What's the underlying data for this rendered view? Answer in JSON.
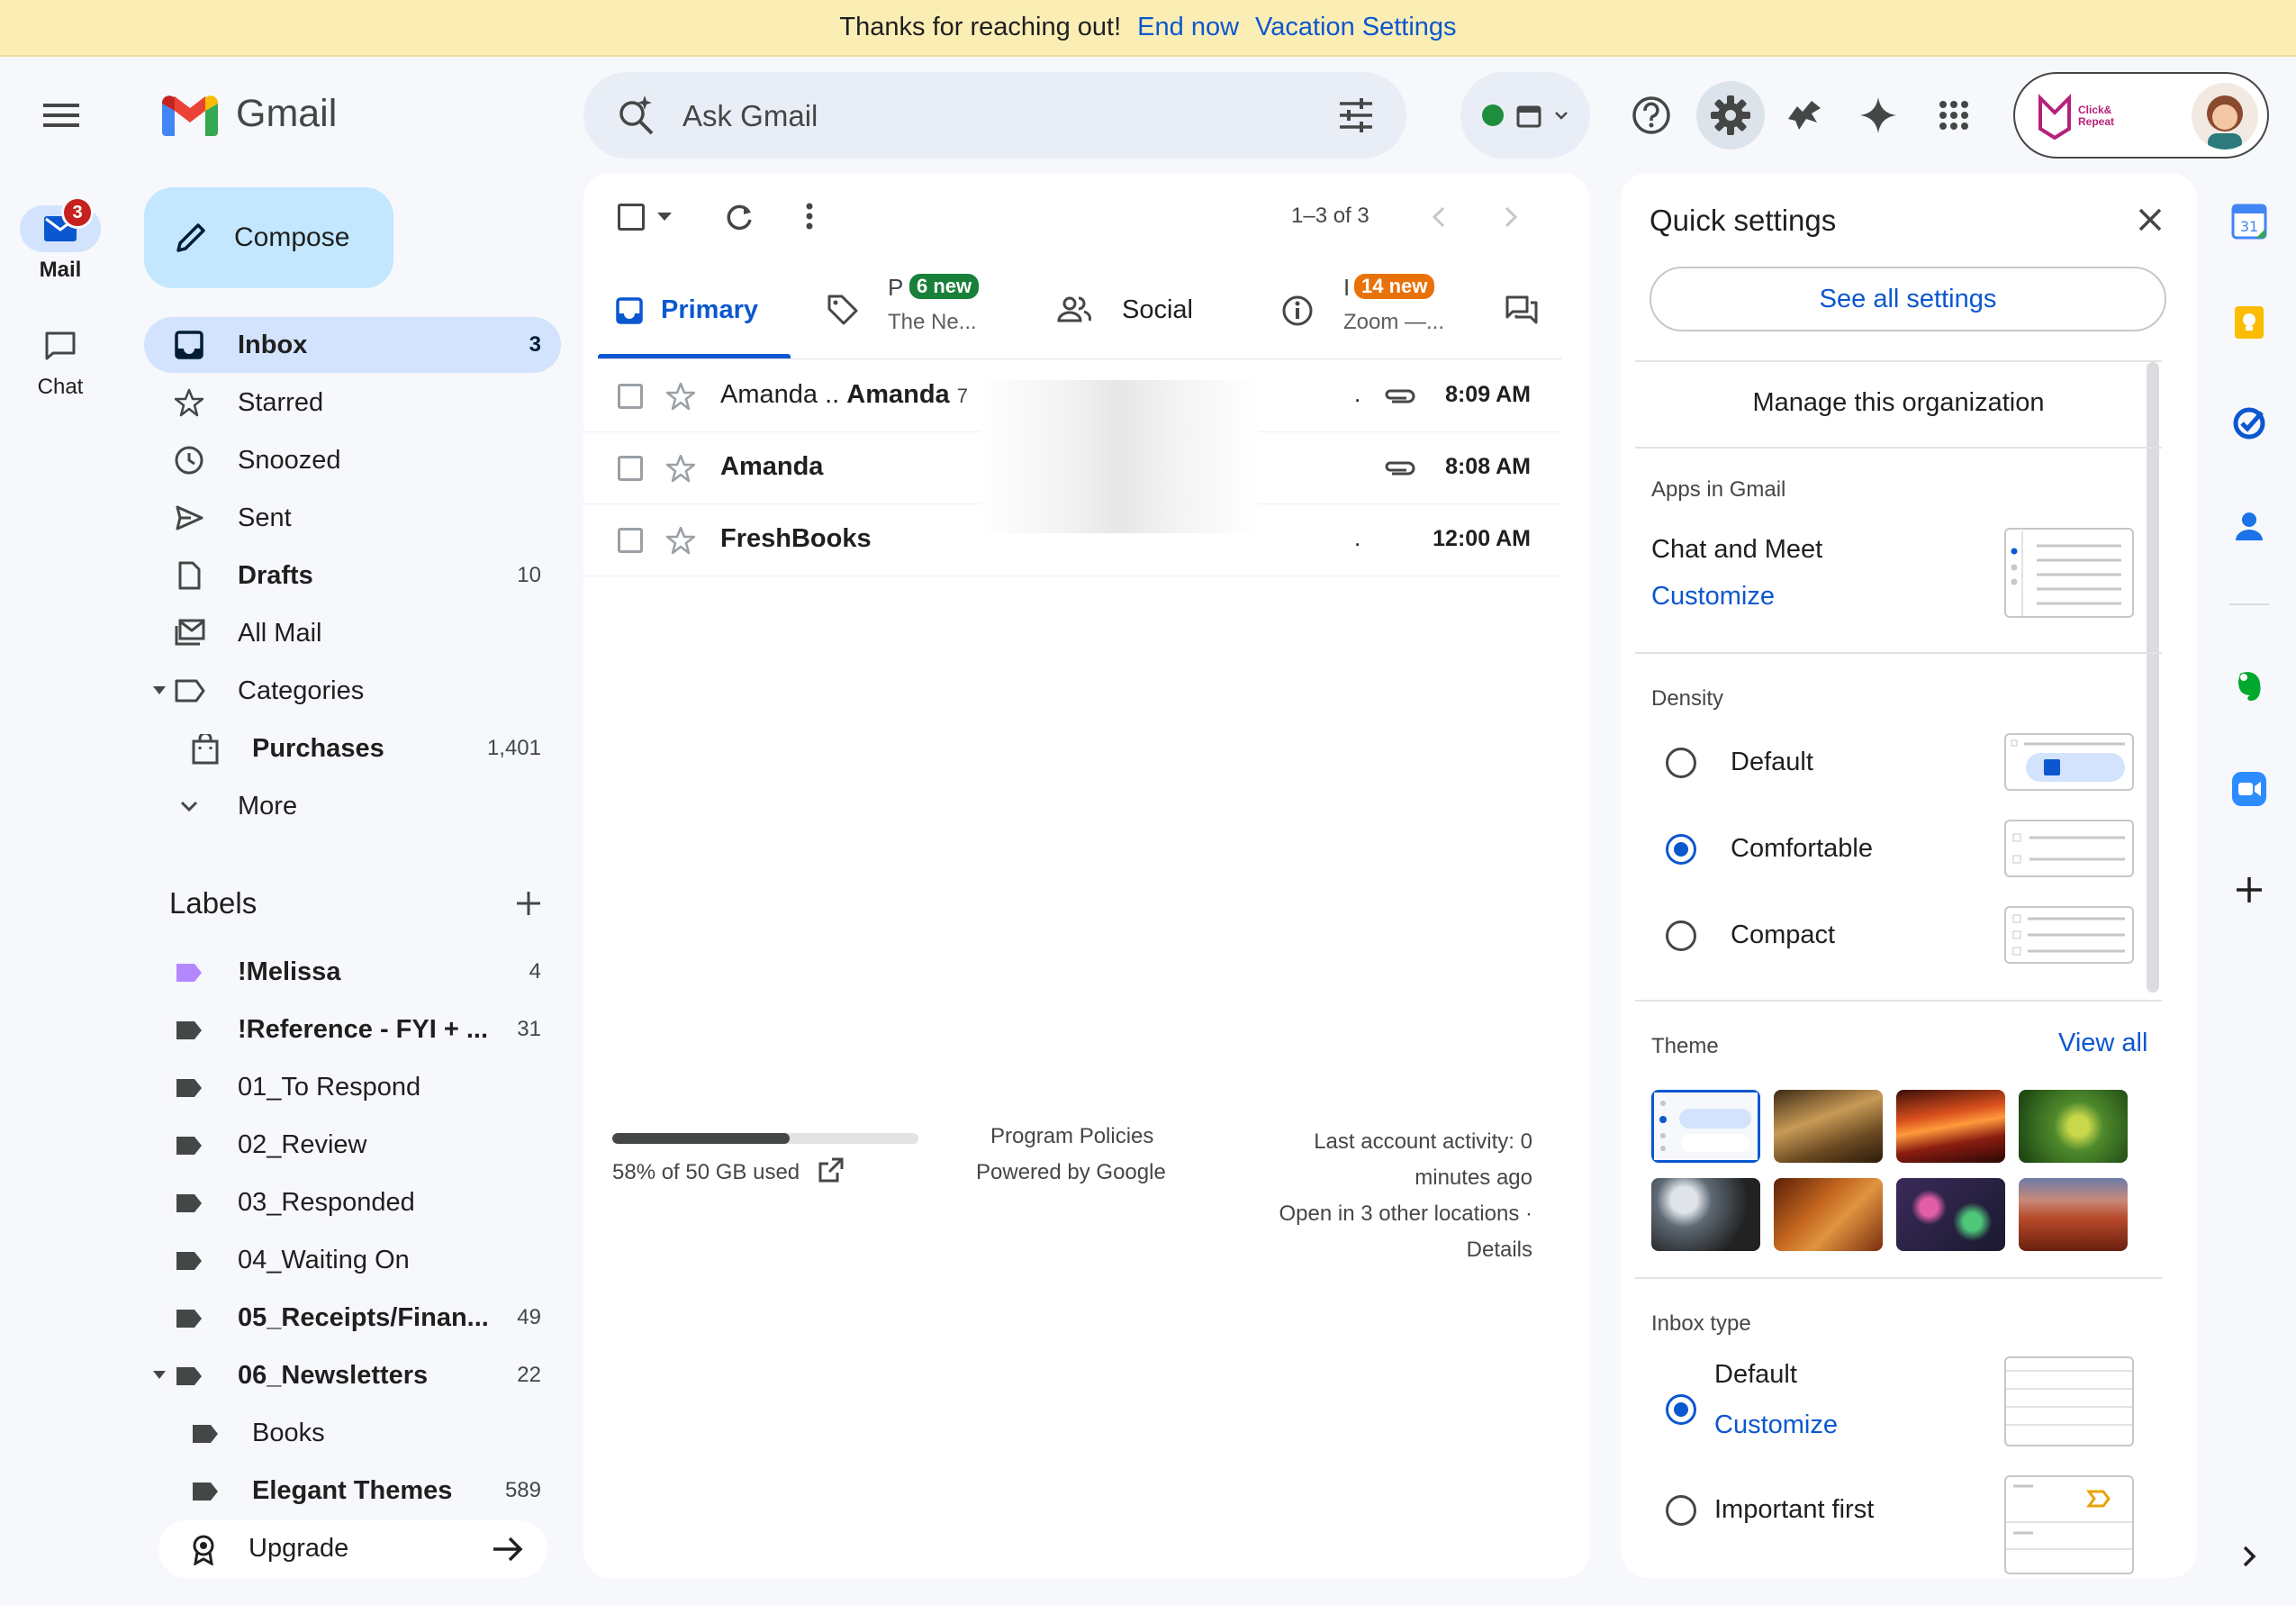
{
  "banner": {
    "message": "Thanks for reaching out!",
    "end_now": "End now",
    "vacation_settings": "Vacation Settings"
  },
  "rail": {
    "mail_label": "Mail",
    "mail_badge": "3",
    "chat_label": "Chat"
  },
  "header": {
    "app_name": "Gmail",
    "search_placeholder": "Ask Gmail",
    "org_logo_text": "Click& Repeat"
  },
  "compose": {
    "label": "Compose"
  },
  "nav": {
    "items": [
      {
        "label": "Inbox",
        "count": "3"
      },
      {
        "label": "Starred",
        "count": ""
      },
      {
        "label": "Snoozed",
        "count": ""
      },
      {
        "label": "Sent",
        "count": ""
      },
      {
        "label": "Drafts",
        "count": "10"
      },
      {
        "label": "All Mail",
        "count": ""
      },
      {
        "label": "Categories",
        "count": ""
      },
      {
        "label": "Purchases",
        "count": "1,401"
      },
      {
        "label": "More",
        "count": ""
      }
    ]
  },
  "labels": {
    "title": "Labels",
    "items": [
      {
        "label": "!Melissa",
        "count": "4",
        "color": "#b388ff"
      },
      {
        "label": "!Reference - FYI + ...",
        "count": "31",
        "color": "#444746"
      },
      {
        "label": "01_To Respond",
        "count": "",
        "color": "#444746"
      },
      {
        "label": "02_Review",
        "count": "",
        "color": "#444746"
      },
      {
        "label": "03_Responded",
        "count": "",
        "color": "#444746"
      },
      {
        "label": "04_Waiting On",
        "count": "",
        "color": "#444746"
      },
      {
        "label": "05_Receipts/Finan...",
        "count": "49",
        "color": "#444746"
      },
      {
        "label": "06_Newsletters",
        "count": "22",
        "color": "#444746"
      },
      {
        "label": "Books",
        "count": "",
        "color": "#444746"
      },
      {
        "label": "Elegant Themes",
        "count": "589",
        "color": "#444746"
      }
    ],
    "upgrade": "Upgrade"
  },
  "toolbar": {
    "pagination": "1–3 of 3"
  },
  "tabs": [
    {
      "label": "Primary"
    },
    {
      "label": "P",
      "badge": "6 new",
      "badge_color": "#188038",
      "sub": "The Ne..."
    },
    {
      "label": "Social"
    },
    {
      "label": "I",
      "badge": "14 new",
      "badge_color": "#e8710a",
      "sub": "Zoom —..."
    }
  ],
  "emails": [
    {
      "sender_a": "Amanda ..",
      "sender_b": "Amanda",
      "thread_count": "7",
      "dot": ".",
      "time": "8:09 AM"
    },
    {
      "sender": "Amanda",
      "time": "8:08 AM"
    },
    {
      "sender": "FreshBooks",
      "dot": ".",
      "time": "12:00 AM"
    }
  ],
  "footer": {
    "storage_text": "58% of 50 GB used",
    "storage_fraction": 0.58,
    "program_policies": "Program Policies",
    "powered_by": "Powered by Google",
    "last_activity_1": "Last account activity: 0",
    "last_activity_2": "minutes ago",
    "open_locations": "Open in 3 other locations ·",
    "details": "Details"
  },
  "quick_settings": {
    "title": "Quick settings",
    "see_all": "See all settings",
    "manage_org": "Manage this organization",
    "apps_heading": "Apps in Gmail",
    "chat_meet": "Chat and Meet",
    "customize": "Customize",
    "density_heading": "Density",
    "density_options": [
      "Default",
      "Comfortable",
      "Compact"
    ],
    "density_selected": "Comfortable",
    "theme_heading": "Theme",
    "view_all": "View all",
    "inbox_type_heading": "Inbox type",
    "inbox_default": "Default",
    "inbox_customize": "Customize",
    "important_first": "Important first"
  },
  "colors": {
    "accent": "#0b57d0",
    "compose_bg": "#c2e7ff",
    "active_nav": "#d3e3fd",
    "banner_bg": "#fbeeb5",
    "page_bg": "#f6f8fc"
  }
}
